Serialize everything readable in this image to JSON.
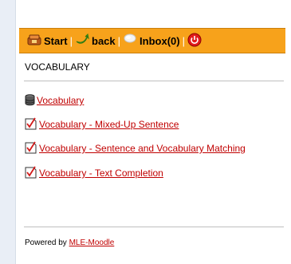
{
  "nav": {
    "start_label": "Start",
    "back_label": "back",
    "inbox_label": "Inbox(0)",
    "separator": "|",
    "icons": [
      "start-icon",
      "back-arrow-icon",
      "inbox-icon",
      "power-icon"
    ]
  },
  "page_heading": "VOCABULARY",
  "links": [
    {
      "label": "Vocabulary",
      "icon": "database-icon"
    },
    {
      "label": "Vocabulary - Mixed-Up Sentence",
      "icon": "quiz-checkbox-icon"
    },
    {
      "label": "Vocabulary - Sentence and Vocabulary Matching",
      "icon": "quiz-checkbox-icon"
    },
    {
      "label": "Vocabulary - Text Completion",
      "icon": "quiz-checkbox-icon"
    }
  ],
  "footer": {
    "powered_by_text": "Powered by",
    "link_label": "MLE-Moodle"
  },
  "colors": {
    "nav_bar": "#f7a21b",
    "link": "#c00000",
    "page_background": "#e9eef6"
  }
}
